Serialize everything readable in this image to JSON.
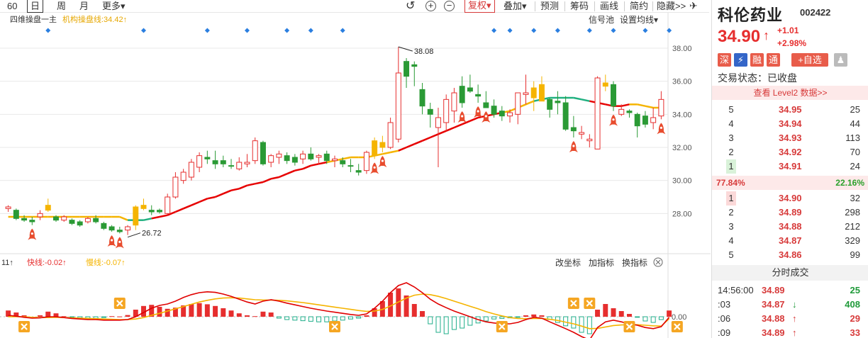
{
  "toolbar": {
    "period_tabs": [
      {
        "label": "60"
      },
      {
        "label": "日",
        "active": true
      },
      {
        "label": "周"
      },
      {
        "label": "月"
      },
      {
        "label": "更多▾"
      }
    ],
    "fuquan": "复权▾",
    "buttons": [
      "叠加▾",
      "预测",
      "筹码",
      "画线",
      "简约",
      "隐藏>>"
    ]
  },
  "chart": {
    "main_label": "四维操盘一主",
    "ma_label": "机构操盘线:34.42↑",
    "signal_pool": "信号池",
    "ma_settings": "设置均线▾",
    "price_ticks": [
      "38.00",
      "36.00",
      "34.00",
      "32.00",
      "30.00",
      "28.00"
    ],
    "price_range": [
      26.0,
      39.2
    ],
    "high_label": "38.08",
    "low_label": "26.72",
    "sub_prefix": "11↑",
    "fast_line": "快线:-0.02↑",
    "slow_line": "慢线:-0.07↑",
    "sub_buttons": [
      "改坐标",
      "加指标",
      "换指标"
    ],
    "sub_tick": "0.00",
    "colors": {
      "up": "#e62e2e",
      "down": "#2a9a35",
      "yellow": "#f5b400",
      "ma_red": "#e60000",
      "ma_yellow": "#f5b400",
      "ma_green": "#20b080",
      "diamond": "#2b7fe0",
      "grid": "#e8e8e8"
    }
  },
  "chart_data": {
    "type": "candlestick",
    "title": "四维操盘一主",
    "ylim": [
      26.0,
      39.2
    ],
    "candles": [
      [
        28.3,
        28.5,
        28.1,
        28.4
      ],
      [
        28.2,
        28.3,
        27.6,
        27.7
      ],
      [
        27.6,
        27.9,
        27.5,
        27.7
      ],
      [
        27.6,
        27.8,
        27.3,
        27.5
      ],
      [
        27.8,
        28.2,
        27.6,
        28.0
      ],
      [
        28.5,
        28.9,
        28.1,
        28.2
      ],
      [
        27.8,
        27.9,
        27.5,
        27.6
      ],
      [
        27.6,
        27.9,
        27.5,
        27.8
      ],
      [
        27.4,
        27.7,
        27.3,
        27.6
      ],
      [
        27.3,
        27.6,
        27.2,
        27.5
      ],
      [
        27.5,
        27.8,
        27.4,
        27.7
      ],
      [
        27.7,
        27.9,
        27.4,
        27.5
      ],
      [
        27.4,
        27.5,
        27.0,
        27.1
      ],
      [
        27.2,
        27.3,
        26.9,
        27.0
      ],
      [
        27.0,
        27.2,
        26.8,
        26.9
      ],
      [
        27.0,
        27.3,
        26.7,
        27.2
      ],
      [
        27.3,
        28.5,
        27.0,
        28.4
      ],
      [
        28.5,
        28.9,
        28.2,
        28.3
      ],
      [
        28.2,
        28.5,
        27.9,
        28.1
      ],
      [
        28.2,
        28.3,
        28.0,
        28.1
      ],
      [
        28.0,
        29.2,
        27.9,
        29.0
      ],
      [
        29.0,
        30.5,
        28.9,
        30.2
      ],
      [
        30.0,
        30.7,
        29.8,
        30.5
      ],
      [
        30.2,
        31.3,
        30.0,
        31.1
      ],
      [
        30.8,
        31.7,
        30.5,
        31.5
      ],
      [
        31.4,
        31.8,
        31.0,
        31.3
      ],
      [
        31.2,
        31.8,
        30.7,
        31.0
      ],
      [
        31.2,
        31.5,
        30.8,
        31.0
      ],
      [
        30.9,
        31.3,
        30.7,
        30.9
      ],
      [
        30.7,
        31.4,
        30.6,
        31.1
      ],
      [
        31.1,
        31.6,
        30.8,
        31.0
      ],
      [
        31.2,
        32.6,
        31.0,
        32.4
      ],
      [
        32.3,
        32.4,
        30.9,
        31.0
      ],
      [
        31.1,
        31.6,
        30.8,
        31.5
      ],
      [
        31.4,
        31.8,
        31.0,
        31.6
      ],
      [
        31.5,
        31.7,
        31.0,
        31.2
      ],
      [
        31.1,
        31.6,
        30.9,
        31.4
      ],
      [
        31.3,
        31.8,
        31.0,
        31.6
      ],
      [
        31.6,
        32.0,
        31.2,
        31.3
      ],
      [
        31.4,
        31.6,
        31.0,
        31.5
      ],
      [
        31.6,
        31.8,
        31.0,
        31.2
      ],
      [
        31.2,
        31.5,
        30.8,
        31.3
      ],
      [
        31.2,
        31.4,
        30.8,
        31.0
      ],
      [
        30.9,
        31.3,
        30.5,
        30.9
      ],
      [
        30.6,
        31.0,
        30.3,
        30.5
      ],
      [
        30.6,
        31.8,
        30.4,
        31.7
      ],
      [
        31.5,
        32.6,
        31.3,
        32.4
      ],
      [
        32.0,
        32.7,
        31.7,
        32.3
      ],
      [
        32.0,
        33.8,
        31.9,
        33.5
      ],
      [
        32.5,
        38.08,
        32.3,
        36.5
      ],
      [
        36.3,
        37.4,
        35.6,
        37.2
      ],
      [
        37.0,
        37.2,
        35.7,
        36.9
      ],
      [
        35.5,
        35.9,
        34.0,
        34.5
      ],
      [
        34.3,
        34.7,
        33.2,
        34.0
      ],
      [
        33.2,
        34.4,
        30.8,
        33.8
      ],
      [
        33.5,
        35.2,
        33.0,
        34.9
      ],
      [
        34.2,
        35.6,
        33.5,
        35.3
      ],
      [
        35.7,
        36.3,
        34.4,
        34.7
      ],
      [
        35.4,
        36.4,
        35.3,
        35.6
      ],
      [
        35.1,
        35.8,
        34.7,
        35.2
      ],
      [
        34.7,
        35.4,
        34.4,
        34.4
      ],
      [
        34.5,
        34.9,
        33.8,
        34.0
      ],
      [
        34.2,
        34.5,
        33.6,
        33.9
      ],
      [
        33.9,
        34.3,
        33.5,
        34.1
      ],
      [
        34.0,
        35.1,
        33.4,
        35.3
      ],
      [
        35.2,
        36.4,
        34.6,
        35.3
      ],
      [
        35.6,
        36.0,
        34.2,
        35.0
      ],
      [
        35.8,
        36.3,
        34.8,
        34.8
      ],
      [
        34.9,
        35.0,
        33.8,
        34.3
      ],
      [
        34.8,
        35.4,
        34.0,
        34.7
      ],
      [
        34.7,
        35.1,
        33.0,
        33.1
      ],
      [
        33.2,
        33.9,
        32.6,
        33.0
      ],
      [
        32.9,
        33.3,
        32.5,
        32.8
      ],
      [
        32.5,
        32.8,
        32.0,
        32.4
      ],
      [
        36.2,
        36.3,
        31.9,
        31.9
      ],
      [
        35.9,
        36.4,
        35.4,
        35.7
      ],
      [
        35.8,
        36.0,
        34.2,
        34.5
      ],
      [
        34.3,
        34.6,
        33.9,
        34.0
      ],
      [
        34.2,
        34.3,
        33.8,
        34.1
      ],
      [
        34.0,
        34.1,
        32.6,
        33.3
      ],
      [
        33.4,
        34.2,
        33.2,
        33.9
      ],
      [
        33.8,
        34.4,
        33.1,
        33.5
      ],
      [
        33.9,
        35.4,
        33.7,
        34.9
      ]
    ],
    "colors": [
      "up",
      "dn",
      "dn",
      "dn",
      "up",
      "ye",
      "dn",
      "up",
      "dn",
      "dn",
      "up",
      "dn",
      "dn",
      "dn",
      "dn",
      "up",
      "ye",
      "ye",
      "dn",
      "dn",
      "up",
      "up",
      "up",
      "up",
      "up",
      "dn",
      "dn",
      "dn",
      "dn",
      "up",
      "up",
      "up",
      "dn",
      "up",
      "up",
      "dn",
      "dn",
      "up",
      "dn",
      "up",
      "dn",
      "up",
      "dn",
      "dn",
      "dn",
      "up",
      "ye",
      "ye",
      "up",
      "up",
      "dn",
      "dn",
      "dn",
      "dn",
      "up",
      "up",
      "up",
      "dn",
      "dn",
      "dn",
      "dn",
      "dn",
      "dn",
      "up",
      "up",
      "up",
      "ye",
      "ye",
      "dn",
      "dn",
      "dn",
      "dn",
      "up",
      "up",
      "up",
      "ye",
      "dn",
      "up",
      "dn",
      "dn",
      "dn",
      "up",
      "up",
      "ye"
    ],
    "ma": [
      27.8,
      27.8,
      27.8,
      27.8,
      27.8,
      27.8,
      27.8,
      27.8,
      27.8,
      27.8,
      27.8,
      27.8,
      27.8,
      27.8,
      27.8,
      27.6,
      27.6,
      27.6,
      27.7,
      27.8,
      27.9,
      28.1,
      28.3,
      28.5,
      28.7,
      28.9,
      29.0,
      29.2,
      29.4,
      29.5,
      29.7,
      29.8,
      29.9,
      30.1,
      30.2,
      30.4,
      30.6,
      30.7,
      30.9,
      31.0,
      31.1,
      31.2,
      31.3,
      31.4,
      31.4,
      31.4,
      31.5,
      31.6,
      31.7,
      31.8,
      32.0,
      32.2,
      32.4,
      32.6,
      32.8,
      33.0,
      33.2,
      33.4,
      33.6,
      33.8,
      33.9,
      34.0,
      34.1,
      34.2,
      34.4,
      34.6,
      34.8,
      34.9,
      35.0,
      35.0,
      35.0,
      35.0,
      34.9,
      34.8,
      34.7,
      34.6,
      34.5,
      34.5,
      34.6,
      34.6,
      34.5,
      34.4,
      34.4,
      34.42
    ],
    "diamonds_at": [
      5,
      17,
      25,
      30,
      35,
      38,
      42,
      61,
      63,
      66,
      69,
      73,
      76,
      80,
      83
    ],
    "rockets_at": [
      3,
      13,
      14,
      46,
      47,
      57,
      59,
      60,
      71,
      76,
      82
    ],
    "macd_hist": [
      0.22,
      0.15,
      0.05,
      0.0,
      0.05,
      0.18,
      0.12,
      0.02,
      -0.02,
      -0.05,
      -0.08,
      -0.06,
      -0.03,
      0.02,
      0.01,
      0.06,
      0.25,
      0.38,
      0.42,
      0.35,
      0.28,
      0.32,
      0.4,
      0.45,
      0.48,
      0.44,
      0.38,
      0.3,
      0.22,
      0.12,
      0.05,
      0.02,
      0.18,
      0.15,
      -0.05,
      -0.1,
      -0.12,
      -0.14,
      -0.16,
      -0.18,
      -0.18,
      -0.15,
      -0.12,
      -0.08,
      -0.05,
      0.05,
      0.3,
      0.55,
      0.85,
      1.0,
      0.75,
      0.45,
      0.2,
      -0.25,
      -0.55,
      -0.6,
      -0.45,
      -0.4,
      -0.3,
      -0.22,
      -0.15,
      -0.08,
      -0.06,
      -0.04,
      -0.02,
      0.05,
      0.08,
      0.05,
      -0.1,
      -0.2,
      -0.32,
      -0.4,
      -0.55,
      -0.6,
      0.25,
      0.45,
      0.3,
      0.2,
      0.1,
      -0.02,
      -0.15,
      -0.2,
      -0.1,
      0.22
    ],
    "macd_fast": [
      0.05,
      0.02,
      -0.02,
      -0.05,
      -0.04,
      0.0,
      0.0,
      -0.03,
      -0.06,
      -0.08,
      -0.1,
      -0.1,
      -0.12,
      -0.12,
      -0.12,
      -0.1,
      0.0,
      0.15,
      0.3,
      0.4,
      0.45,
      0.55,
      0.68,
      0.78,
      0.85,
      0.88,
      0.86,
      0.8,
      0.72,
      0.62,
      0.52,
      0.45,
      0.55,
      0.6,
      0.55,
      0.48,
      0.42,
      0.36,
      0.3,
      0.25,
      0.2,
      0.16,
      0.12,
      0.08,
      0.05,
      0.1,
      0.3,
      0.55,
      0.85,
      1.1,
      1.2,
      1.05,
      0.85,
      0.62,
      0.45,
      0.32,
      0.2,
      0.1,
      0.0,
      -0.1,
      -0.18,
      -0.22,
      -0.25,
      -0.25,
      -0.2,
      -0.1,
      -0.02,
      -0.05,
      -0.18,
      -0.3,
      -0.42,
      -0.55,
      -0.7,
      -0.82,
      -0.38,
      -0.18,
      -0.12,
      -0.18,
      -0.25,
      -0.3,
      -0.38,
      -0.42,
      -0.35,
      -0.02
    ],
    "macd_slow": [
      0.0,
      0.0,
      0.0,
      -0.02,
      -0.03,
      -0.03,
      -0.02,
      -0.03,
      -0.04,
      -0.05,
      -0.06,
      -0.07,
      -0.08,
      -0.09,
      -0.1,
      -0.1,
      -0.08,
      -0.03,
      0.05,
      0.12,
      0.2,
      0.28,
      0.36,
      0.44,
      0.52,
      0.58,
      0.63,
      0.66,
      0.67,
      0.66,
      0.63,
      0.6,
      0.59,
      0.59,
      0.58,
      0.56,
      0.53,
      0.5,
      0.46,
      0.42,
      0.38,
      0.34,
      0.3,
      0.26,
      0.22,
      0.19,
      0.2,
      0.26,
      0.38,
      0.52,
      0.66,
      0.76,
      0.8,
      0.78,
      0.72,
      0.64,
      0.55,
      0.46,
      0.37,
      0.28,
      0.18,
      0.1,
      0.03,
      -0.03,
      -0.06,
      -0.07,
      -0.06,
      -0.06,
      -0.09,
      -0.13,
      -0.19,
      -0.25,
      -0.33,
      -0.42,
      -0.41,
      -0.36,
      -0.31,
      -0.29,
      -0.28,
      -0.28,
      -0.3,
      -0.32,
      -0.33,
      -0.07
    ],
    "x_markers_at": [
      2,
      14,
      41,
      62,
      71,
      73,
      78,
      84
    ]
  },
  "stock": {
    "name": "科伦药业",
    "code": "002422",
    "price": "34.90",
    "arrow": "↑",
    "change": "+1.01",
    "change_pct": "+2.98%",
    "tags": [
      "深",
      "⚡",
      "融",
      "通",
      "+自选"
    ],
    "status": "交易状态：已收盘",
    "level2": "查看 Level2 数据>>",
    "sells": [
      {
        "lvl": "5",
        "price": "34.95",
        "vol": "25"
      },
      {
        "lvl": "4",
        "price": "34.94",
        "vol": "44"
      },
      {
        "lvl": "3",
        "price": "34.93",
        "vol": "113"
      },
      {
        "lvl": "2",
        "price": "34.92",
        "vol": "70"
      },
      {
        "lvl": "1",
        "price": "34.91",
        "vol": "24"
      }
    ],
    "ratio_buy": "77.84%",
    "ratio_sell": "22.16%",
    "buys": [
      {
        "lvl": "1",
        "price": "34.90",
        "vol": "32"
      },
      {
        "lvl": "2",
        "price": "34.89",
        "vol": "298"
      },
      {
        "lvl": "3",
        "price": "34.88",
        "vol": "212"
      },
      {
        "lvl": "4",
        "price": "34.87",
        "vol": "329"
      },
      {
        "lvl": "5",
        "price": "34.86",
        "vol": "99"
      }
    ],
    "tick_title": "分时成交",
    "ticks": [
      {
        "t": "14:56:00",
        "p": "34.89",
        "a": "",
        "v": "25",
        "dir": "dn"
      },
      {
        "t": ":03",
        "p": "34.87",
        "a": "↓",
        "v": "408",
        "dir": "dn"
      },
      {
        "t": ":06",
        "p": "34.88",
        "a": "↑",
        "v": "29",
        "dir": "up"
      },
      {
        "t": ":09",
        "p": "34.89",
        "a": "↑",
        "v": "33",
        "dir": "up"
      }
    ]
  }
}
